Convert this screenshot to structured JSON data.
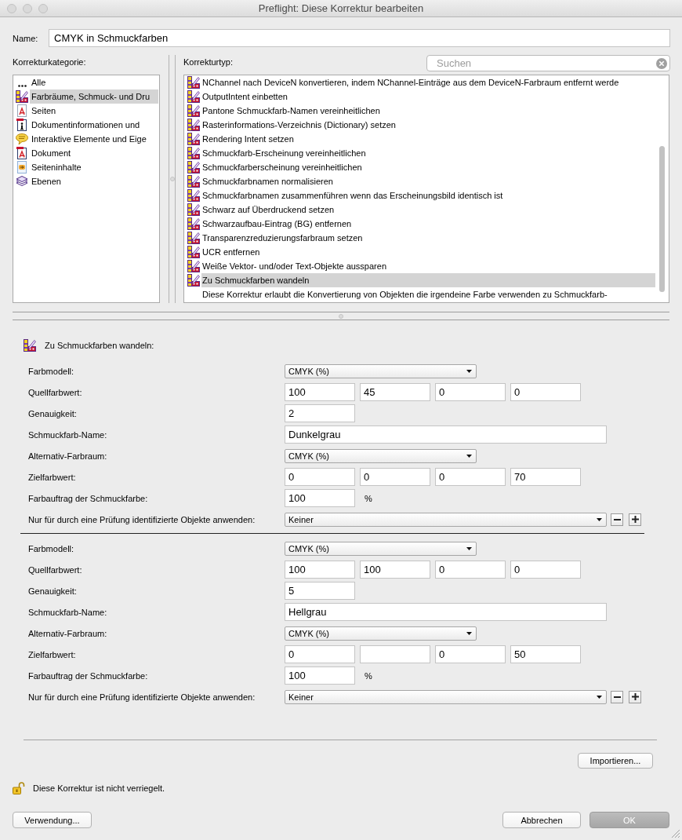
{
  "window": {
    "title": "Preflight: Diese Korrektur bearbeiten"
  },
  "name": {
    "label": "Name:",
    "value": "CMYK in Schmuckfarben"
  },
  "categories": {
    "label": "Korrekturkategorie:",
    "items": [
      {
        "kind": "all",
        "label": "Alle",
        "selected": false
      },
      {
        "kind": "color",
        "label": "Farbräume, Schmuck- und Dru",
        "selected": true
      },
      {
        "kind": "pages",
        "label": "Seiten",
        "selected": false
      },
      {
        "kind": "info",
        "label": "Dokumentinformationen und",
        "selected": false
      },
      {
        "kind": "interactive",
        "label": "Interaktive Elemente und Eige",
        "selected": false
      },
      {
        "kind": "document",
        "label": "Dokument",
        "selected": false
      },
      {
        "kind": "content",
        "label": "Seiteninhalte",
        "selected": false
      },
      {
        "kind": "layers",
        "label": "Ebenen",
        "selected": false
      }
    ]
  },
  "correction_types": {
    "label": "Korrekturtyp:",
    "search": {
      "placeholder": "Suchen"
    },
    "items": [
      {
        "label": "NChannel nach DeviceN konvertieren, indem NChannel-Einträge aus dem DeviceN-Farbraum entfernt werde",
        "selected": false
      },
      {
        "label": "OutputIntent einbetten",
        "selected": false
      },
      {
        "label": "Pantone Schmuckfarb-Namen vereinheitlichen",
        "selected": false
      },
      {
        "label": "Rasterinformations-Verzeichnis (Dictionary) setzen",
        "selected": false
      },
      {
        "label": "Rendering Intent setzen",
        "selected": false
      },
      {
        "label": "Schmuckfarb-Erscheinung vereinheitlichen",
        "selected": false
      },
      {
        "label": "Schmuckfarberscheinung vereinheitlichen",
        "selected": false
      },
      {
        "label": "Schmuckfarbnamen normalisieren",
        "selected": false
      },
      {
        "label": "Schmuckfarbnamen zusammenführen wenn das Erscheinungsbild identisch ist",
        "selected": false
      },
      {
        "label": "Schwarz auf Überdruckend setzen",
        "selected": false
      },
      {
        "label": "Schwarzaufbau-Eintrag (BG) entfernen",
        "selected": false
      },
      {
        "label": "Transparenzreduzierungsfarbraum setzen",
        "selected": false
      },
      {
        "label": "UCR entfernen",
        "selected": false
      },
      {
        "label": "Weiße Vektor- und/oder Text-Objekte aussparen",
        "selected": false
      },
      {
        "label": "Zu Schmuckfarben wandeln",
        "selected": true
      }
    ],
    "description": "Diese Korrektur erlaubt die Konvertierung von Objekten die irgendeine Farbe verwenden zu Schmuckfarb-"
  },
  "editor": {
    "title": "Zu Schmuckfarben wandeln:",
    "groups": [
      {
        "rows": [
          {
            "kind": "dropdown",
            "label": "Farbmodell:",
            "value": "CMYK (%)"
          },
          {
            "kind": "fields",
            "label": "Quellfarbwert:",
            "fields": [
              {
                "value": "100"
              },
              {
                "value": "45"
              },
              {
                "value": "0"
              },
              {
                "value": "0"
              }
            ]
          },
          {
            "kind": "fields",
            "label": "Genauigkeit:",
            "fields": [
              {
                "value": "2"
              }
            ]
          },
          {
            "kind": "text",
            "label": "Schmuckfarb-Name:",
            "value": "Dunkelgrau"
          },
          {
            "kind": "dropdown",
            "label": "Alternativ-Farbraum:",
            "value": "CMYK (%)"
          },
          {
            "kind": "fields",
            "label": "Zielfarbwert:",
            "fields": [
              {
                "value": "0"
              },
              {
                "value": "0"
              },
              {
                "value": "0"
              },
              {
                "value": "70"
              }
            ]
          },
          {
            "kind": "fields",
            "label": "Farbauftrag der Schmuckfarbe:",
            "fields": [
              {
                "value": "100"
              }
            ],
            "unit": "%"
          },
          {
            "kind": "filter",
            "label": "Nur für durch eine Prüfung identifizierte Objekte anwenden:",
            "value": "Keiner"
          }
        ]
      },
      {
        "rows": [
          {
            "kind": "dropdown",
            "label": "Farbmodell:",
            "value": "CMYK (%)"
          },
          {
            "kind": "fields",
            "label": "Quellfarbwert:",
            "fields": [
              {
                "value": "100"
              },
              {
                "value": "100"
              },
              {
                "value": "0"
              },
              {
                "value": "0"
              }
            ]
          },
          {
            "kind": "fields",
            "label": "Genauigkeit:",
            "fields": [
              {
                "value": "5"
              }
            ]
          },
          {
            "kind": "text",
            "label": "Schmuckfarb-Name:",
            "value": "Hellgrau"
          },
          {
            "kind": "dropdown",
            "label": "Alternativ-Farbraum:",
            "value": "CMYK (%)"
          },
          {
            "kind": "fields",
            "label": "Zielfarbwert:",
            "fields": [
              {
                "kind": "filled",
                "value": "0"
              },
              {
                "kind": "blank"
              },
              {
                "kind": "filled",
                "value": "0"
              },
              {
                "kind": "filled",
                "value": "50"
              }
            ]
          },
          {
            "kind": "fields",
            "label": "Farbauftrag der Schmuckfarbe:",
            "fields": [
              {
                "value": "100"
              }
            ],
            "unit": "%"
          },
          {
            "kind": "filter",
            "label": "Nur für durch eine Prüfung identifizierte Objekte anwenden:",
            "value": "Keiner"
          }
        ]
      }
    ]
  },
  "import_button": "Importieren...",
  "lock_status": "Diese Korrektur ist nicht verriegelt.",
  "footer": {
    "usage_button": "Verwendung...",
    "cancel_button": "Abbrechen",
    "ok_button": "OK"
  }
}
